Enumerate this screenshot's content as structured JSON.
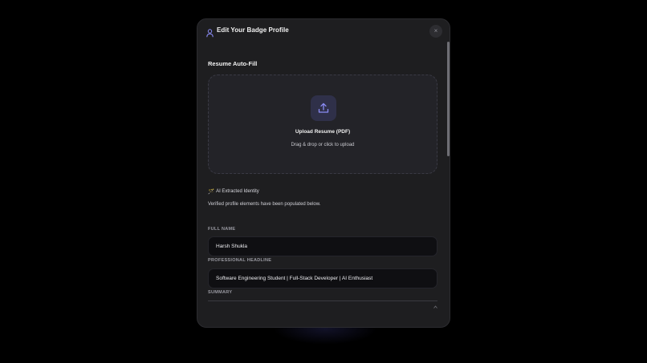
{
  "modal": {
    "title": "Edit Your Badge Profile",
    "close_label": "×",
    "icons": {
      "header": "user-icon",
      "close": "close-icon",
      "upload": "upload-icon",
      "ai": "sparkle-icon"
    }
  },
  "resume": {
    "section_title": "Resume Auto-Fill",
    "upload_title": "Upload Resume (PDF)",
    "upload_hint": "Drag & drop or click to upload"
  },
  "ai": {
    "icon_glyph": "🪄",
    "label": "AI Extracted Identity",
    "description": "Verified profile elements have been populated below."
  },
  "form": {
    "full_name": {
      "label": "FULL NAME",
      "value": "Harsh Shukla"
    },
    "headline": {
      "label": "PROFESSIONAL HEADLINE",
      "value": "Software Engineering Student | Full-Stack Developer | AI Enthusiast"
    },
    "summary": {
      "label": "SUMMARY",
      "value": ""
    }
  },
  "colors": {
    "background": "#000000",
    "modal_bg": "#1e1e20",
    "accent": "#8b8cf5",
    "input_bg": "#0f0f12"
  }
}
